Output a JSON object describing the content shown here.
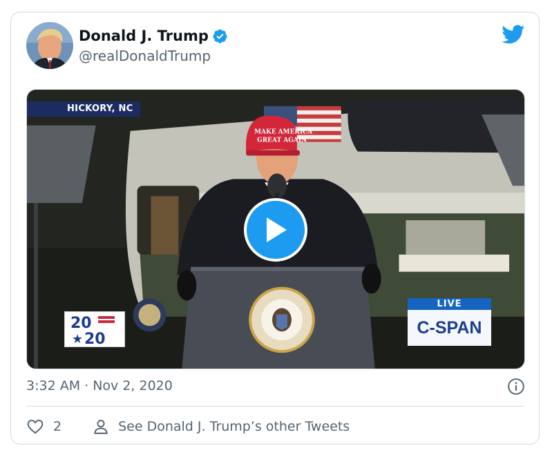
{
  "author": {
    "name": "Donald J. Trump",
    "handle": "@realDonaldTrump",
    "verified": true
  },
  "icons": {
    "avatar": "avatar",
    "verified": "verified-badge-icon",
    "brand": "twitter-bird-icon",
    "play": "play-icon",
    "info": "info-icon",
    "like": "heart-icon",
    "profile": "person-icon"
  },
  "media": {
    "location_chyron": "HICKORY, NC",
    "logo_top": "20",
    "logo_bottom": "20",
    "network_live": "LIVE",
    "network_name": "C-SPAN"
  },
  "timestamp": "3:32 AM · Nov 2, 2020",
  "actions": {
    "like_count": "2",
    "profile_link": "See Donald J. Trump’s other Tweets"
  },
  "colors": {
    "accent": "#1d9bf0",
    "text": "#0f1419",
    "secondary": "#536471",
    "border": "#cfd9de"
  }
}
